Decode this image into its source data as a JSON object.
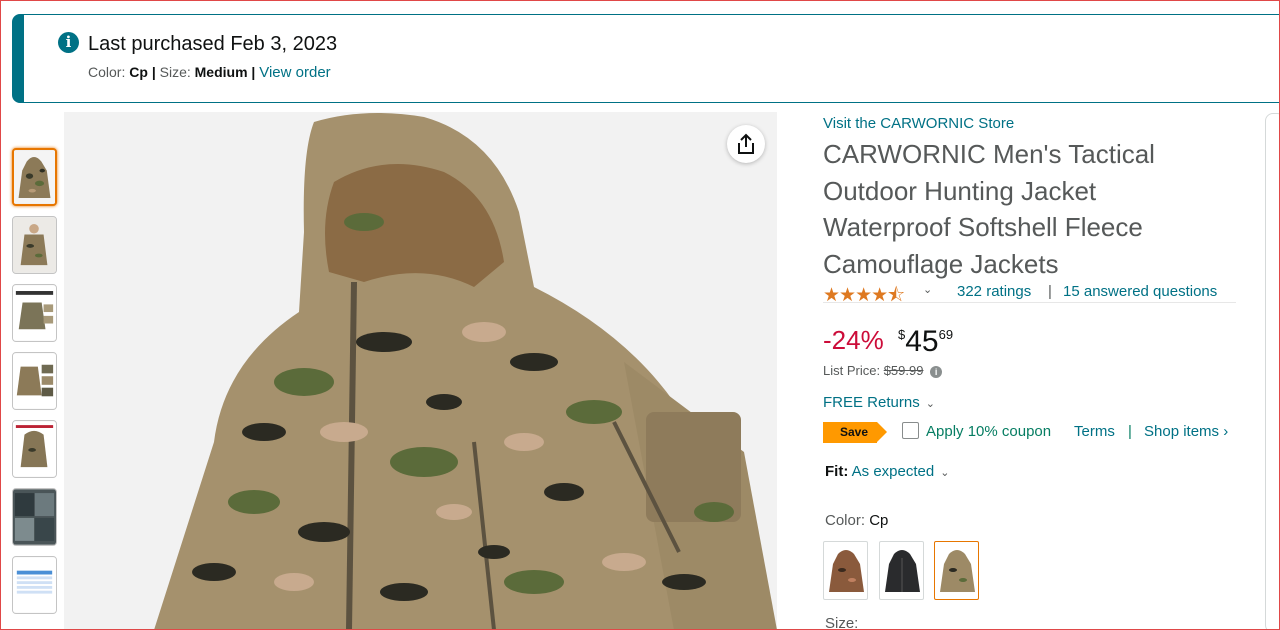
{
  "banner": {
    "title": "Last purchased Feb 3, 2023",
    "color_label": "Color:",
    "color_value": "Cp",
    "size_label": "Size:",
    "size_value": "Medium",
    "view_order": "View order",
    "icon": "info-icon"
  },
  "gallery": {
    "thumbnails": [
      "jacket-front",
      "model-wearing",
      "feature-details",
      "size-details",
      "hood-details",
      "fabric-closeup",
      "size-chart"
    ],
    "selected_index": 0,
    "share_icon": "share-icon"
  },
  "product": {
    "store_link": "Visit the CARWORNIC Store",
    "title": "CARWORNIC Men's Tactical Outdoor Hunting Jacket Waterproof Softshell Fleece Camouflage Jackets",
    "stars": "★★★★⯪",
    "star_rating": 4.5,
    "ratings_link": "322 ratings",
    "separator": "|",
    "questions_link": "15 answered questions"
  },
  "pricing": {
    "discount": "-24%",
    "currency": "$",
    "price_whole": "45",
    "price_fraction": "69",
    "list_price_label": "List Price:",
    "list_price": "$59.99",
    "returns": "FREE Returns",
    "save_badge": "Save",
    "coupon_label": "Apply 10% coupon",
    "terms": "Terms",
    "separator": "|",
    "shop_items": "Shop items ›"
  },
  "fit": {
    "label": "Fit:",
    "value": "As expected"
  },
  "color": {
    "label": "Color:",
    "value": "Cp",
    "swatches": [
      "brown-camo",
      "black",
      "cp-camo"
    ],
    "selected_index": 2
  },
  "size": {
    "label": "Size:"
  },
  "colors": {
    "link": "#007185",
    "accent": "#ff9900",
    "discount": "#cc0c39",
    "coupon": "#067d62",
    "star": "#de7921"
  }
}
